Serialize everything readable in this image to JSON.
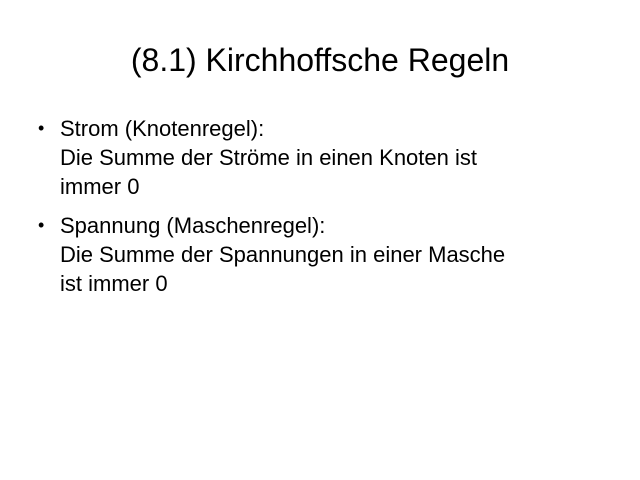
{
  "slide": {
    "title": "(8.1) Kirchhoffsche Regeln",
    "bullet_marker": "•",
    "bullets": [
      {
        "lines": [
          "Strom (Knotenregel):",
          "Die Summe der Ströme in einen Knoten ist",
          "immer 0"
        ]
      },
      {
        "lines": [
          "Spannung (Maschenregel):",
          "Die Summe der Spannungen in einer Masche",
          "ist immer 0"
        ]
      }
    ]
  }
}
